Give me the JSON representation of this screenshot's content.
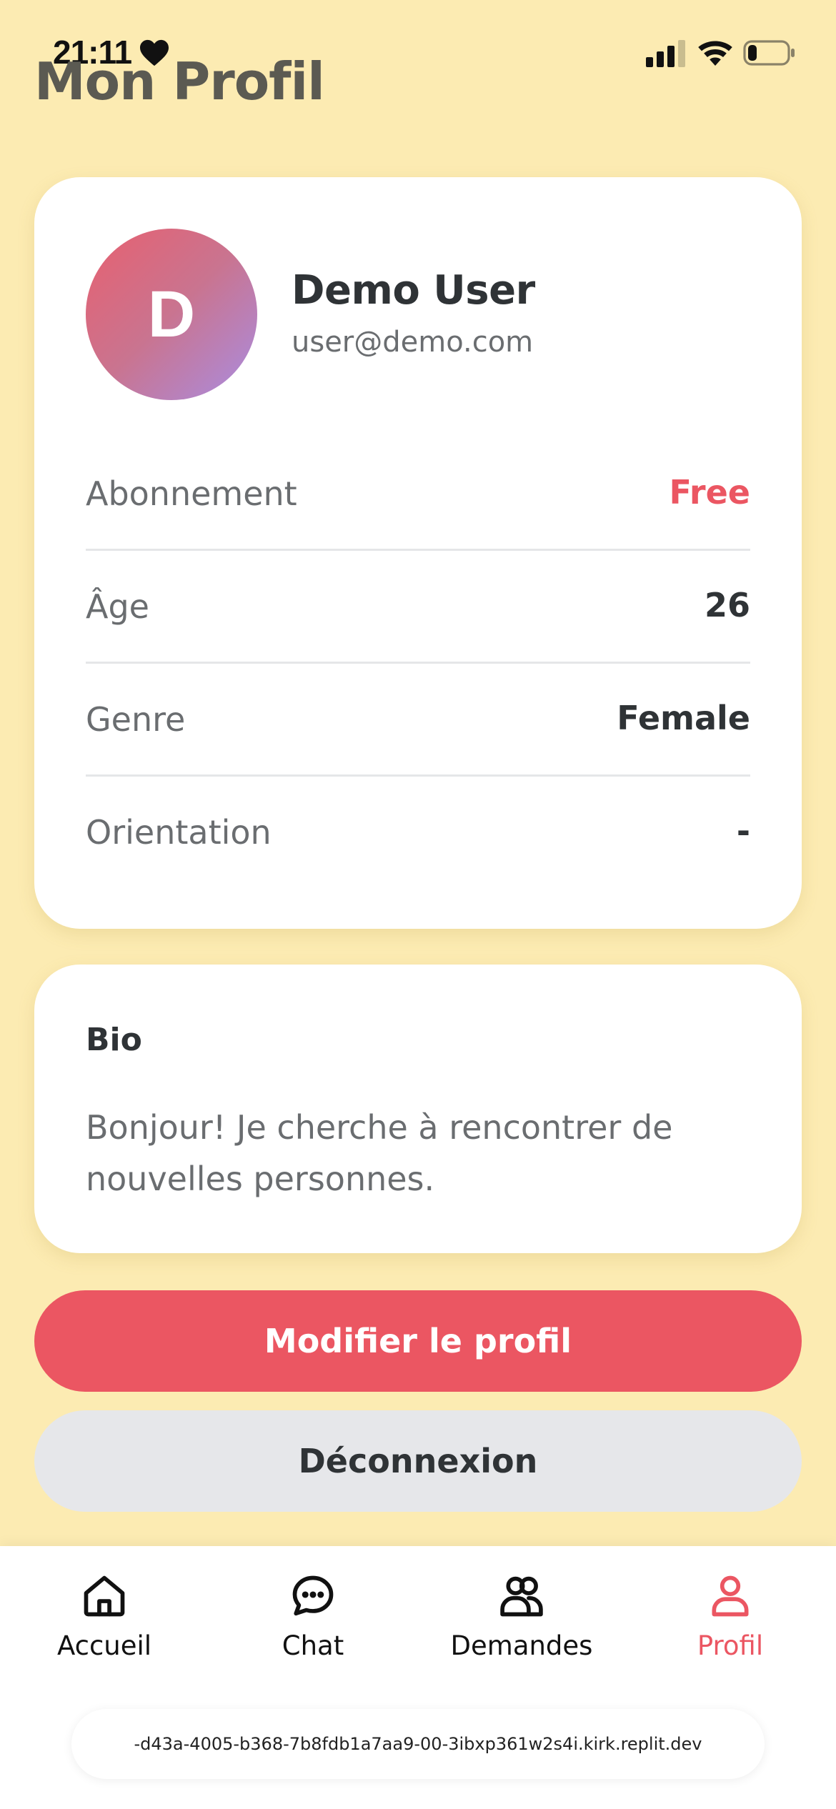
{
  "status_bar": {
    "time": "21:11"
  },
  "header": {
    "title": "Mon Profil"
  },
  "profile": {
    "avatar_initial": "D",
    "name": "Demo User",
    "email": "user@demo.com",
    "rows": [
      {
        "label": "Abonnement",
        "value": "Free"
      },
      {
        "label": "Âge",
        "value": "26"
      },
      {
        "label": "Genre",
        "value": "Female"
      },
      {
        "label": "Orientation",
        "value": "-"
      }
    ]
  },
  "bio": {
    "title": "Bio",
    "text": "Bonjour! Je cherche à rencontrer de nouvelles personnes."
  },
  "actions": {
    "edit_label": "Modifier le profil",
    "logout_label": "Déconnexion"
  },
  "nav": {
    "items": [
      {
        "label": "Accueil",
        "icon": "home-icon"
      },
      {
        "label": "Chat",
        "icon": "chat-bubble-icon"
      },
      {
        "label": "Demandes",
        "icon": "users-icon"
      },
      {
        "label": "Profil",
        "icon": "user-icon",
        "active": true
      }
    ]
  },
  "browser": {
    "url": "-d43a-4005-b368-7b8fdb1a7aa9-00-3ibxp361w2s4i.kirk.replit.dev"
  },
  "colors": {
    "background": "#FCEBB2",
    "accent": "#EB5662",
    "secondary_button": "#E6E7EA",
    "text_dark": "#2F3336",
    "text_muted": "#6A6D70"
  }
}
